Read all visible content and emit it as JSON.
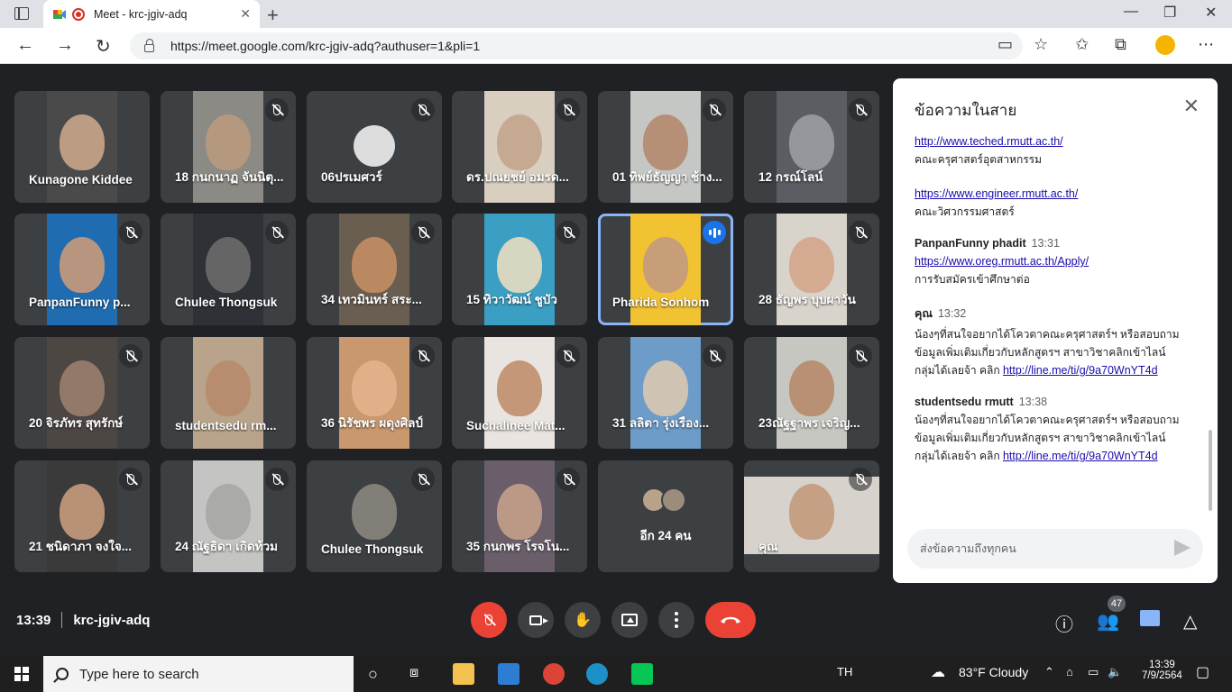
{
  "browser": {
    "tab_title": "Meet - krc-jgiv-adq",
    "url_host": "https://meet.google.com",
    "url_path": "/krc-jgiv-adq?authuser=1&pli=1"
  },
  "participants": [
    {
      "name": "Kunagone Kiddee",
      "muted": false,
      "bg": "#4a4a4a",
      "skin": "#c9a58a"
    },
    {
      "name": "18 กนกนาฏ จันนิตุ...",
      "muted": true,
      "bg": "#8c8a85",
      "skin": "#b89a7e"
    },
    {
      "name": "06ปรเมศวร์",
      "muted": true,
      "bg": "#3c4043",
      "skin": "#dddddd"
    },
    {
      "name": "ดร.ปณยชย์ อมรด...",
      "muted": true,
      "bg": "#d8cfc0",
      "skin": "#c3a48c"
    },
    {
      "name": "01 ทิพย์ธัญญา ช้าง...",
      "muted": true,
      "bg": "#c5c7c4",
      "skin": "#b28a6f"
    },
    {
      "name": "12 กรณ์โลน์",
      "muted": true,
      "bg": "#5a5d62",
      "skin": "#9a9ea3"
    },
    {
      "name": "PanpanFunny p...",
      "muted": true,
      "bg": "#1f6cb0",
      "skin": "#c99a7a"
    },
    {
      "name": "Chulee Thongsuk",
      "muted": true,
      "bg": "#2e3135",
      "skin": "#6b6b6b"
    },
    {
      "name": "34 เทวมินทร์ สระ...",
      "muted": true,
      "bg": "#6a5e50",
      "skin": "#c48e63"
    },
    {
      "name": "15 ทิวาวัฒน์ ชูบัว",
      "muted": true,
      "bg": "#3a9fc2",
      "skin": "#e9dcc0"
    },
    {
      "name": "Pharida Sonhom",
      "muted": false,
      "bg": "#f1c232",
      "skin": "#c29a7e"
    },
    {
      "name": "28 ธัญพร บุบผาวัน",
      "muted": true,
      "bg": "#d8d3cb",
      "skin": "#d4a68a"
    },
    {
      "name": "20 จิรภัทร สุทรักษ์",
      "muted": true,
      "bg": "#4d4744",
      "skin": "#9a7e6e"
    },
    {
      "name": "studentsedu rm...",
      "muted": false,
      "bg": "#b9a48b",
      "skin": "#b88b6c"
    },
    {
      "name": "36 นิรัชพร ผดุงศิลป์",
      "muted": true,
      "bg": "#c9986e",
      "skin": "#e3b18b"
    },
    {
      "name": "Suchalinee Mat...",
      "muted": true,
      "bg": "#e9e4df",
      "skin": "#c08e6e"
    },
    {
      "name": "31 ลลิตา รุ่งเรือง...",
      "muted": true,
      "bg": "#6d9cc8",
      "skin": "#d9c8b0"
    },
    {
      "name": "23ณัฐฐาพร เจริญ...",
      "muted": true,
      "bg": "#c7c7c2",
      "skin": "#b78a6c"
    },
    {
      "name": "21 ชนิดาภา จงใจ...",
      "muted": true,
      "bg": "#3a3a3a",
      "skin": "#c69b7e"
    },
    {
      "name": "24 ณัฐธิดา เกิดท้วม",
      "muted": true,
      "bg": "#c4c4c2",
      "skin": "#a7a7a5"
    },
    {
      "name": "Chulee Thongsuk",
      "muted": true,
      "bg": "#3c4043",
      "skin": "#8a8680"
    },
    {
      "name": "35 กนกพร โรจโน...",
      "muted": true,
      "bg": "#6a5e6b",
      "skin": "#c5a08a"
    },
    {
      "name": "อีก 24 คน",
      "muted": false,
      "bg": "#3c4043",
      "skin": "#3c4043"
    },
    {
      "name": "คุณ",
      "muted": true,
      "bg": "#d7d2cb",
      "skin": "#c39a7c"
    }
  ],
  "chat": {
    "title": "ข้อความในสาย",
    "messages": [
      {
        "sender": "",
        "time": "",
        "lines": [],
        "link": "http://www.teched.rmutt.ac.th/",
        "after": "คณะครุศาสตร์อุตสาหกรรม"
      },
      {
        "sender": "",
        "time": "",
        "lines": [],
        "link": "https://www.engineer.rmutt.ac.th/",
        "after": "คณะวิศวกรรมศาสตร์"
      },
      {
        "sender": "PanpanFunny phadit",
        "time": "13:31",
        "lines": [],
        "link": "https://www.oreg.rmutt.ac.th/Apply/",
        "after": "การรับสมัครเข้าศึกษาต่อ"
      },
      {
        "sender": "คุณ",
        "time": "13:32",
        "lines": [
          "น้องๆที่สนใจอยากได้โควตาคณะครุศาสตร์ฯ หรือสอบถาม",
          "ข้อมูลเพิ่มเติมเกี่ยวกับหลักสูตรฯ สาขาวิชาคลิกเข้าไลน์"
        ],
        "prefix": "กลุ่มได้เลยจ้า คลิก ",
        "link": "http://line.me/ti/g/9a70WnYT4d",
        "after": ""
      },
      {
        "sender": "studentsedu rmutt",
        "time": "13:38",
        "lines": [
          "น้องๆที่สนใจอยากได้โควตาคณะครุศาสตร์ฯ หรือสอบถาม",
          "ข้อมูลเพิ่มเติมเกี่ยวกับหลักสูตรฯ สาขาวิชาคลิกเข้าไลน์"
        ],
        "prefix": "กลุ่มได้เลยจ้า คลิก ",
        "link": "http://line.me/ti/g/9a70WnYT4d",
        "after": ""
      }
    ],
    "input_placeholder": "ส่งข้อความถึงทุกคน"
  },
  "meeting": {
    "time": "13:39",
    "code": "krc-jgiv-adq",
    "participant_count": "47"
  },
  "taskbar": {
    "search_placeholder": "Type here to search",
    "lang": "TH",
    "weather": "83°F  Cloudy",
    "clock_time": "13:39",
    "clock_date": "7/9/2564"
  },
  "colors": {
    "end_call": "#ea4335",
    "accent_blue": "#1a73e8",
    "active_outline": "#8ab4f8"
  }
}
